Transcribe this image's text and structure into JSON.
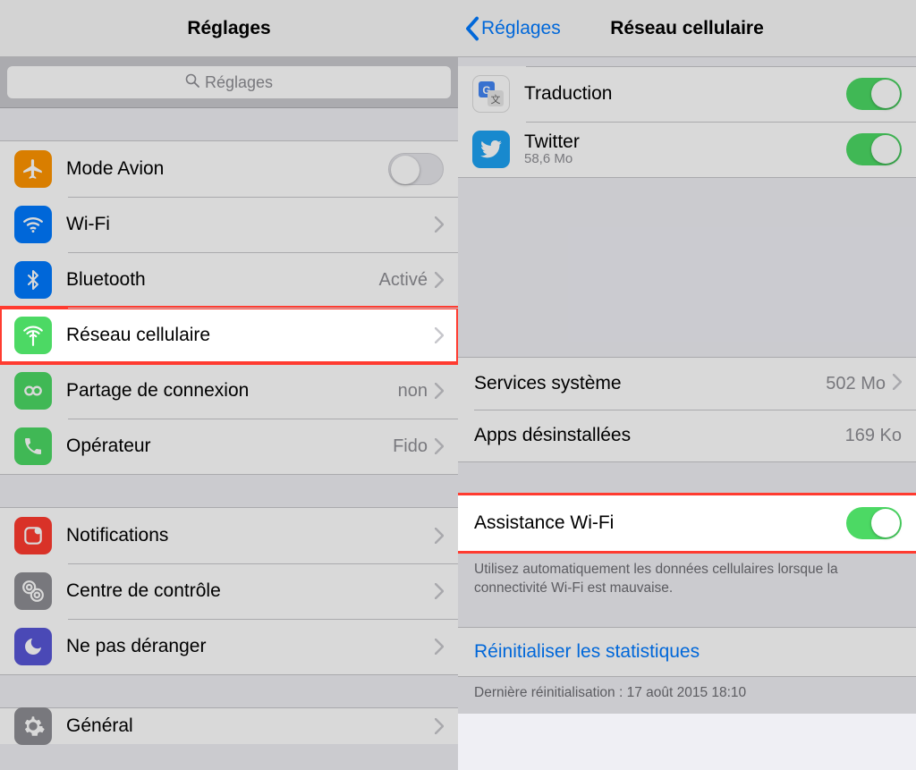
{
  "left": {
    "title": "Réglages",
    "searchPlaceholder": "Réglages",
    "group1": {
      "airplane": "Mode Avion",
      "wifi": "Wi-Fi",
      "bluetooth": "Bluetooth",
      "bluetooth_value": "Activé",
      "cellular": "Réseau cellulaire",
      "hotspot": "Partage de connexion",
      "hotspot_value": "non",
      "carrier": "Opérateur",
      "carrier_value": "Fido"
    },
    "group2": {
      "notifications": "Notifications",
      "controlcenter": "Centre de contrôle",
      "dnd": "Ne pas déranger"
    },
    "group3": {
      "general": "Général"
    }
  },
  "right": {
    "back": "Réglages",
    "title": "Réseau cellulaire",
    "apps": {
      "traduction": {
        "name": "Traduction"
      },
      "twitter": {
        "name": "Twitter",
        "size": "58,6 Mo"
      }
    },
    "system": {
      "label": "Services système",
      "value": "502 Mo"
    },
    "uninstalled": {
      "label": "Apps désinstallées",
      "value": "169 Ko"
    },
    "wifiassist": {
      "label": "Assistance Wi-Fi"
    },
    "assist_footer": "Utilisez automatiquement les données cellulaires lorsque la connectivité Wi-Fi est mauvaise.",
    "reset": "Réinitialiser les statistiques",
    "last_reset": "Dernière réinitialisation : 17 août 2015 18:10"
  },
  "colors": {
    "orange": "#ff9500",
    "blue": "#007aff",
    "green": "#4cd964",
    "darkgreen": "#34c759",
    "red": "#ff3b30",
    "purple": "#5856d6",
    "grey": "#8e8e93",
    "twitter": "#1da1f2",
    "translate": "#4285f4"
  }
}
